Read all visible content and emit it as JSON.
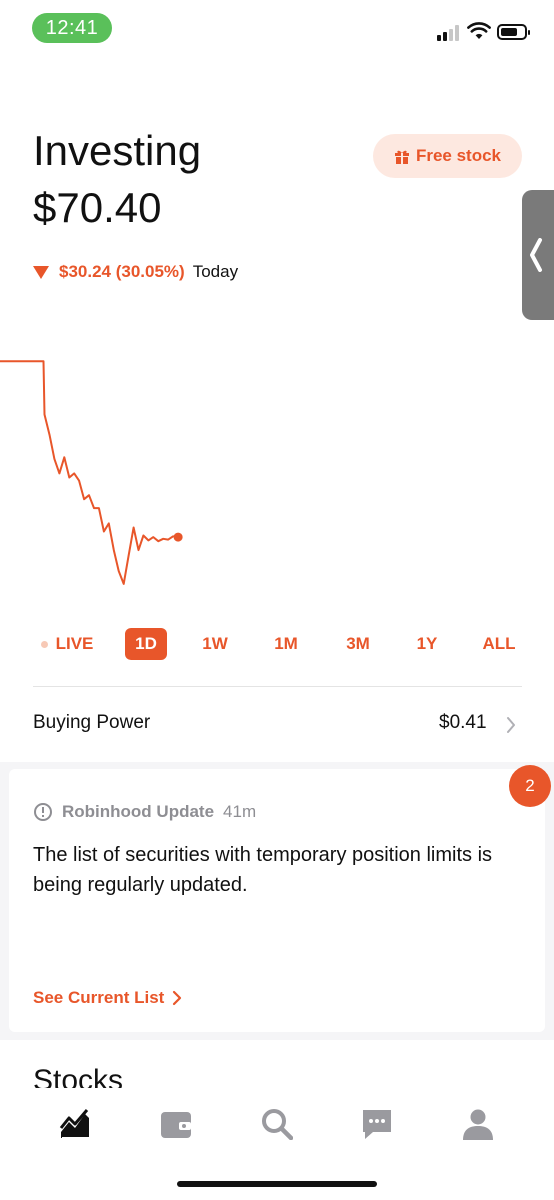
{
  "status_bar": {
    "time": "12:41"
  },
  "header": {
    "title": "Investing",
    "balance": "$70.40",
    "free_stock_label": "Free stock",
    "change_amount": "$30.24 (30.05%)",
    "change_period": "Today",
    "change_direction": "down"
  },
  "colors": {
    "accent": "#e8562a",
    "accent_light": "#fde8e0",
    "muted": "#8e8e93",
    "status_green": "#5ac05a"
  },
  "chart_data": {
    "type": "line",
    "title": "",
    "xlabel": "",
    "ylabel": "",
    "series": [
      {
        "name": "",
        "x": [
          0,
          0.88,
          0.9,
          1,
          1.1,
          1.2,
          1.3,
          1.4,
          1.5,
          1.6,
          1.7,
          1.8,
          1.9,
          2,
          2.1,
          2.2,
          2.3,
          2.4,
          2.5,
          2.6,
          2.7,
          2.8,
          2.9,
          3.0,
          3.1,
          3.2,
          3.3,
          3.4,
          3.5,
          3.6
        ],
        "y": [
          100.6,
          100.6,
          94.0,
          91.5,
          88.5,
          86.7,
          88.7,
          86.2,
          86.7,
          85.8,
          83.5,
          84.0,
          82.4,
          82.4,
          79.5,
          80.5,
          77.2,
          74.6,
          73.0,
          76.5,
          80.0,
          77.2,
          79.0,
          78.4,
          78.8,
          78.3,
          78.6,
          78.5,
          78.9,
          78.8
        ]
      }
    ]
  },
  "ranges": [
    {
      "label": "LIVE"
    },
    {
      "label": "1D"
    },
    {
      "label": "1W"
    },
    {
      "label": "1M"
    },
    {
      "label": "3M"
    },
    {
      "label": "1Y"
    },
    {
      "label": "ALL"
    }
  ],
  "active_range": "1D",
  "buying_power": {
    "label": "Buying Power",
    "value": "$0.41"
  },
  "update_card": {
    "badge": "2",
    "source": "Robinhood Update",
    "time": "41m",
    "message": "The list of securities with temporary position limits is being regularly updated.",
    "link": "See Current List"
  },
  "section_title": "Stocks",
  "tabs": [
    {
      "icon": "chart-icon",
      "active": true
    },
    {
      "icon": "wallet-icon",
      "active": false
    },
    {
      "icon": "search-icon",
      "active": false
    },
    {
      "icon": "chat-icon",
      "active": false
    },
    {
      "icon": "profile-icon",
      "active": false
    }
  ]
}
